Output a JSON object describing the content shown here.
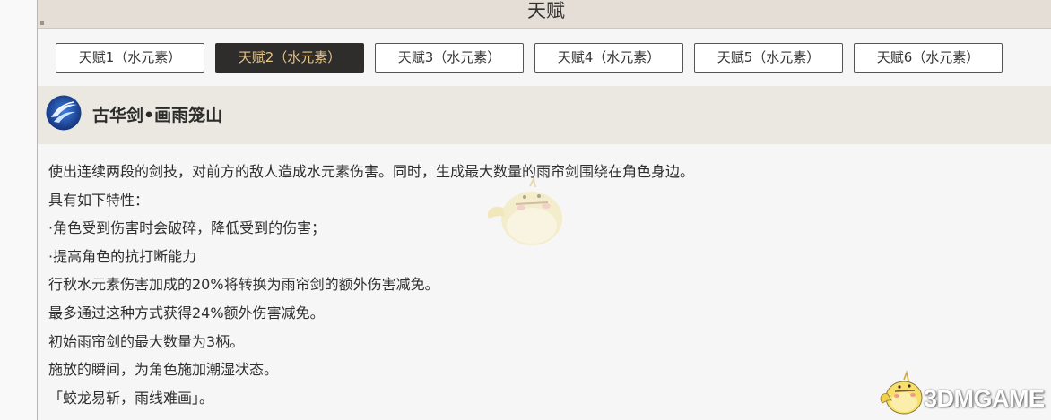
{
  "header": {
    "title": "天赋"
  },
  "tabs": [
    {
      "label": "天赋1（水元素）",
      "active": false
    },
    {
      "label": "天赋2（水元素）",
      "active": true
    },
    {
      "label": "天赋3（水元素）",
      "active": false
    },
    {
      "label": "天赋4（水元素）",
      "active": false
    },
    {
      "label": "天赋5（水元素）",
      "active": false
    },
    {
      "label": "天赋6（水元素）",
      "active": false
    }
  ],
  "skill": {
    "icon": "water-sword-swirl-icon",
    "name": "古华剑•画雨笼山"
  },
  "description": [
    "使出连续两段的剑技，对前方的敌人造成水元素伤害。同时，生成最大数量的雨帘剑围绕在角色身边。",
    "具有如下特性：",
    "·角色受到伤害时会破碎，降低受到的伤害；",
    "·提高角色的抗打断能力",
    "行秋水元素伤害加成的20%将转换为雨帘剑的额外伤害减免。",
    "最多通过这种方式获得24%额外伤害减免。",
    "初始雨帘剑的最大数量为3柄。",
    "施放的瞬间，为角色施加潮湿状态。",
    "「蛟龙易斩，雨线难画」。"
  ],
  "watermark": {
    "text": "3DMGAME",
    "icon": "duck-mascot-icon"
  },
  "colors": {
    "header_bg": "#e5ded6",
    "active_tab_bg": "#2f2d2b",
    "active_tab_text": "#e5c48a",
    "skill_bar_bg": "#ebe7e1"
  }
}
